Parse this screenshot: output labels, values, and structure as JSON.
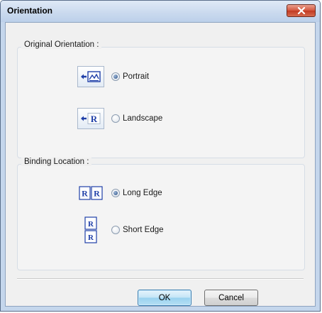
{
  "window": {
    "title": "Orientation"
  },
  "original_orientation": {
    "label": "Original Orientation :",
    "options": [
      {
        "label": "Portrait",
        "selected": true,
        "icon": "portrait-orientation-icon"
      },
      {
        "label": "Landscape",
        "selected": false,
        "icon": "landscape-orientation-icon"
      }
    ]
  },
  "binding_location": {
    "label": "Binding Location :",
    "options": [
      {
        "label": "Long Edge",
        "selected": true,
        "icon": "long-edge-binding-icon"
      },
      {
        "label": "Short Edge",
        "selected": false,
        "icon": "short-edge-binding-icon"
      }
    ]
  },
  "buttons": {
    "ok": "OK",
    "cancel": "Cancel"
  },
  "colors": {
    "accent_blue": "#1f3fa8",
    "close_red": "#c23a22"
  }
}
